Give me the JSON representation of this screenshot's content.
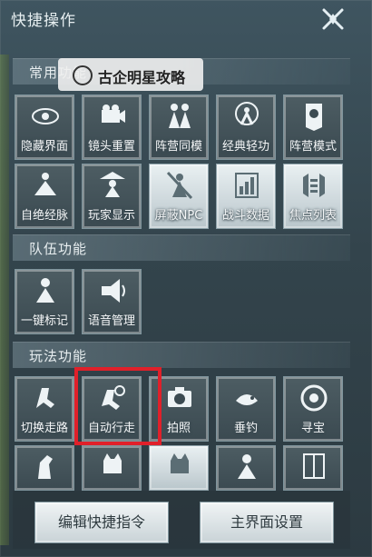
{
  "window": {
    "title": "快捷操作",
    "close_icon": "close-icon"
  },
  "watermark": {
    "text": "古企明星攻略"
  },
  "sections": {
    "common": {
      "label": "常用功能"
    },
    "team": {
      "label": "队伍功能"
    },
    "gameplay": {
      "label": "玩法功能"
    }
  },
  "common_buttons": [
    {
      "label": "隐藏界面",
      "icon": "eye-icon"
    },
    {
      "label": "镜头重置",
      "icon": "camera-icon"
    },
    {
      "label": "阵营同模",
      "icon": "figures-icon"
    },
    {
      "label": "经典轻功",
      "icon": "jump-icon"
    },
    {
      "label": "阵营模式",
      "icon": "banner-icon"
    },
    {
      "label": "自绝经脉",
      "icon": "meditate-icon"
    },
    {
      "label": "玩家显示",
      "icon": "hat-figure-icon"
    },
    {
      "label": "屏蔽NPC",
      "icon": "npc-hide-icon"
    },
    {
      "label": "战斗数据",
      "icon": "chart-icon"
    },
    {
      "label": "焦点列表",
      "icon": "focus-list-icon"
    }
  ],
  "team_buttons": [
    {
      "label": "一键标记",
      "icon": "mark-icon"
    },
    {
      "label": "语音管理",
      "icon": "megaphone-icon"
    }
  ],
  "gameplay_buttons": [
    {
      "label": "切换走路",
      "icon": "walk-icon"
    },
    {
      "label": "自动行走",
      "icon": "auto-walk-icon"
    },
    {
      "label": "拍照",
      "icon": "photo-icon"
    },
    {
      "label": "垂钓",
      "icon": "fishing-icon"
    },
    {
      "label": "寻宝",
      "icon": "treasure-icon"
    },
    {
      "label": "",
      "icon": "horse-icon"
    },
    {
      "label": "",
      "icon": "cat-icon"
    },
    {
      "label": "",
      "icon": "cat2-icon"
    },
    {
      "label": "",
      "icon": "person-icon"
    },
    {
      "label": "",
      "icon": "cabinet-icon"
    }
  ],
  "footer": {
    "edit_label": "编辑快捷指令",
    "main_ui_label": "主界面设置"
  },
  "colors": {
    "highlight": "#e0202a",
    "panel": "#3b4a50"
  }
}
